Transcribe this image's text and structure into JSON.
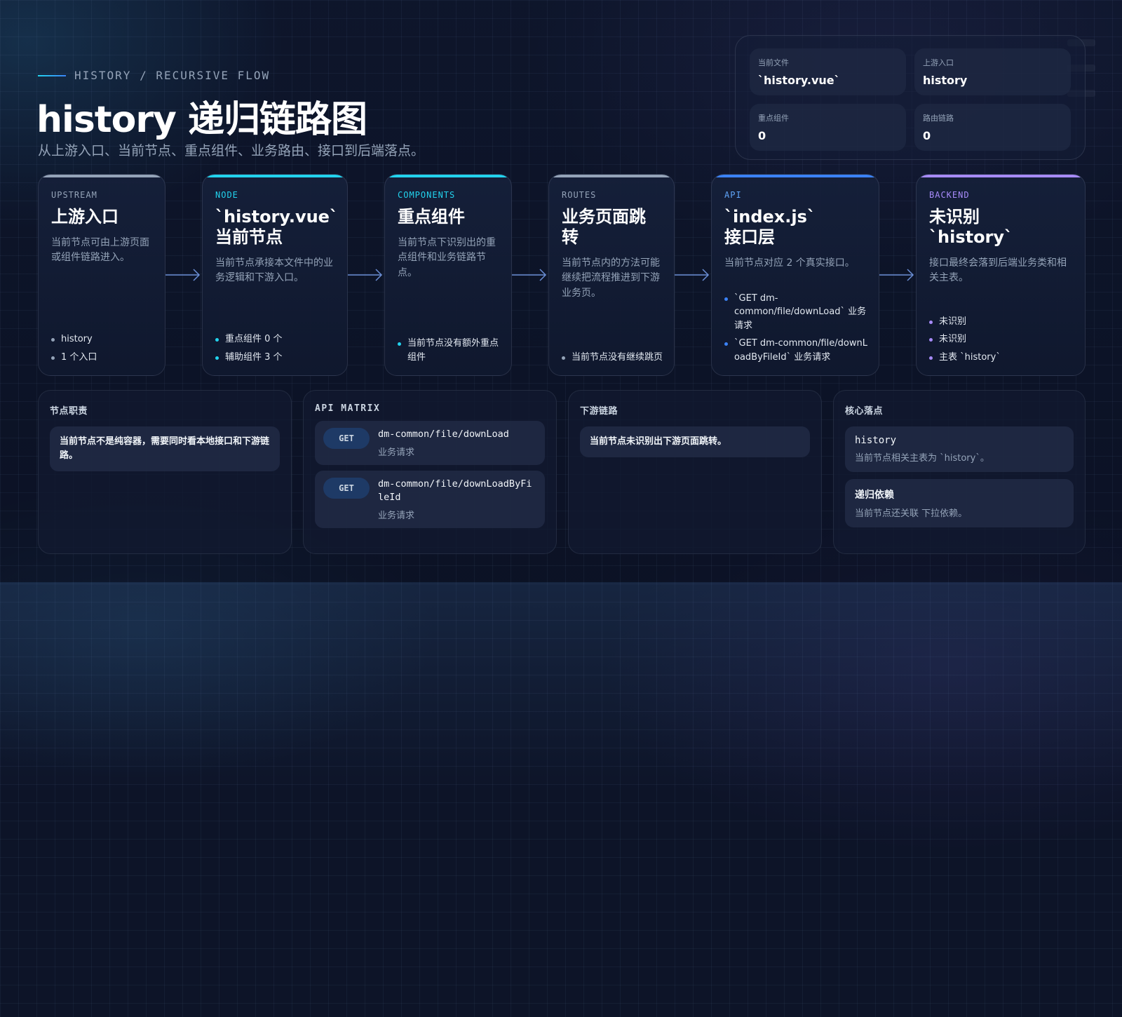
{
  "header": {
    "eyebrow": "HISTORY / RECURSIVE FLOW",
    "title": "history 递归链路图",
    "subtitle": "从上游入口、当前节点、重点组件、业务路由、接口到后端落点。"
  },
  "stats": [
    {
      "label": "当前文件",
      "value": "`history.vue`"
    },
    {
      "label": "上游入口",
      "value": "history"
    },
    {
      "label": "重点组件",
      "value": "0"
    },
    {
      "label": "路由链路",
      "value": "0"
    }
  ],
  "flow": [
    {
      "tag": "UPSTREAM",
      "title": "上游入口",
      "desc": "当前节点可由上游页面或组件链路进入。",
      "bullets": [
        "history",
        "1 个入口"
      ],
      "accent": "#94a3b8",
      "tag_color": "#94a3b8",
      "dot": "#94a3b8"
    },
    {
      "tag": "NODE",
      "title": "`history.vue`\n当前节点",
      "desc": "当前节点承接本文件中的业务逻辑和下游入口。",
      "bullets": [
        "重点组件 0 个",
        "辅助组件 3 个"
      ],
      "accent": "#22d3ee",
      "tag_color": "#22d3ee",
      "dot": "#22d3ee"
    },
    {
      "tag": "COMPONENTS",
      "title": "重点组件",
      "desc": "当前节点下识别出的重点组件和业务链路节点。",
      "bullets": [
        "当前节点没有额外重点组件"
      ],
      "accent": "#22d3ee",
      "tag_color": "#22d3ee",
      "dot": "#22d3ee"
    },
    {
      "tag": "ROUTES",
      "title": "业务页面跳转",
      "desc": "当前节点内的方法可能继续把流程推进到下游业务页。",
      "bullets": [
        "当前节点没有继续跳页"
      ],
      "accent": "#94a3b8",
      "tag_color": "#94a3b8",
      "dot": "#94a3b8"
    },
    {
      "tag": "API",
      "title": "`index.js`\n接口层",
      "desc": "当前节点对应 2 个真实接口。",
      "bullets": [
        "`GET dm-common/file/downLoad` 业务请求",
        "`GET dm-common/file/downLoadByFileId` 业务请求"
      ],
      "accent": "#3b82f6",
      "tag_color": "#60a5fa",
      "dot": "#3b82f6"
    },
    {
      "tag": "BACKEND",
      "title": "未识别\n`history`",
      "desc": "接口最终会落到后端业务类和相关主表。",
      "bullets": [
        "未识别",
        "未识别",
        "主表 `history`"
      ],
      "accent": "#a78bfa",
      "tag_color": "#a78bfa",
      "dot": "#a78bfa"
    }
  ],
  "panels": {
    "duty": {
      "title": "节点职责",
      "note": "当前节点不是纯容器，需要同时看本地接口和下游链路。"
    },
    "api_matrix": {
      "title": "API MATRIX",
      "rows": [
        {
          "method": "GET",
          "path": "dm-common/file/downLoad",
          "kind": "业务请求"
        },
        {
          "method": "GET",
          "path": "dm-common/file/downLoadByFileId",
          "kind": "业务请求"
        }
      ]
    },
    "downstream": {
      "title": "下游链路",
      "note": "当前节点未识别出下游页面跳转。"
    },
    "core": {
      "title": "核心落点",
      "items": [
        {
          "name": "history",
          "desc": "当前节点相关主表为 `history`。"
        },
        {
          "name": "递归依赖",
          "desc": "当前节点还关联 下拉依赖。"
        }
      ]
    }
  }
}
